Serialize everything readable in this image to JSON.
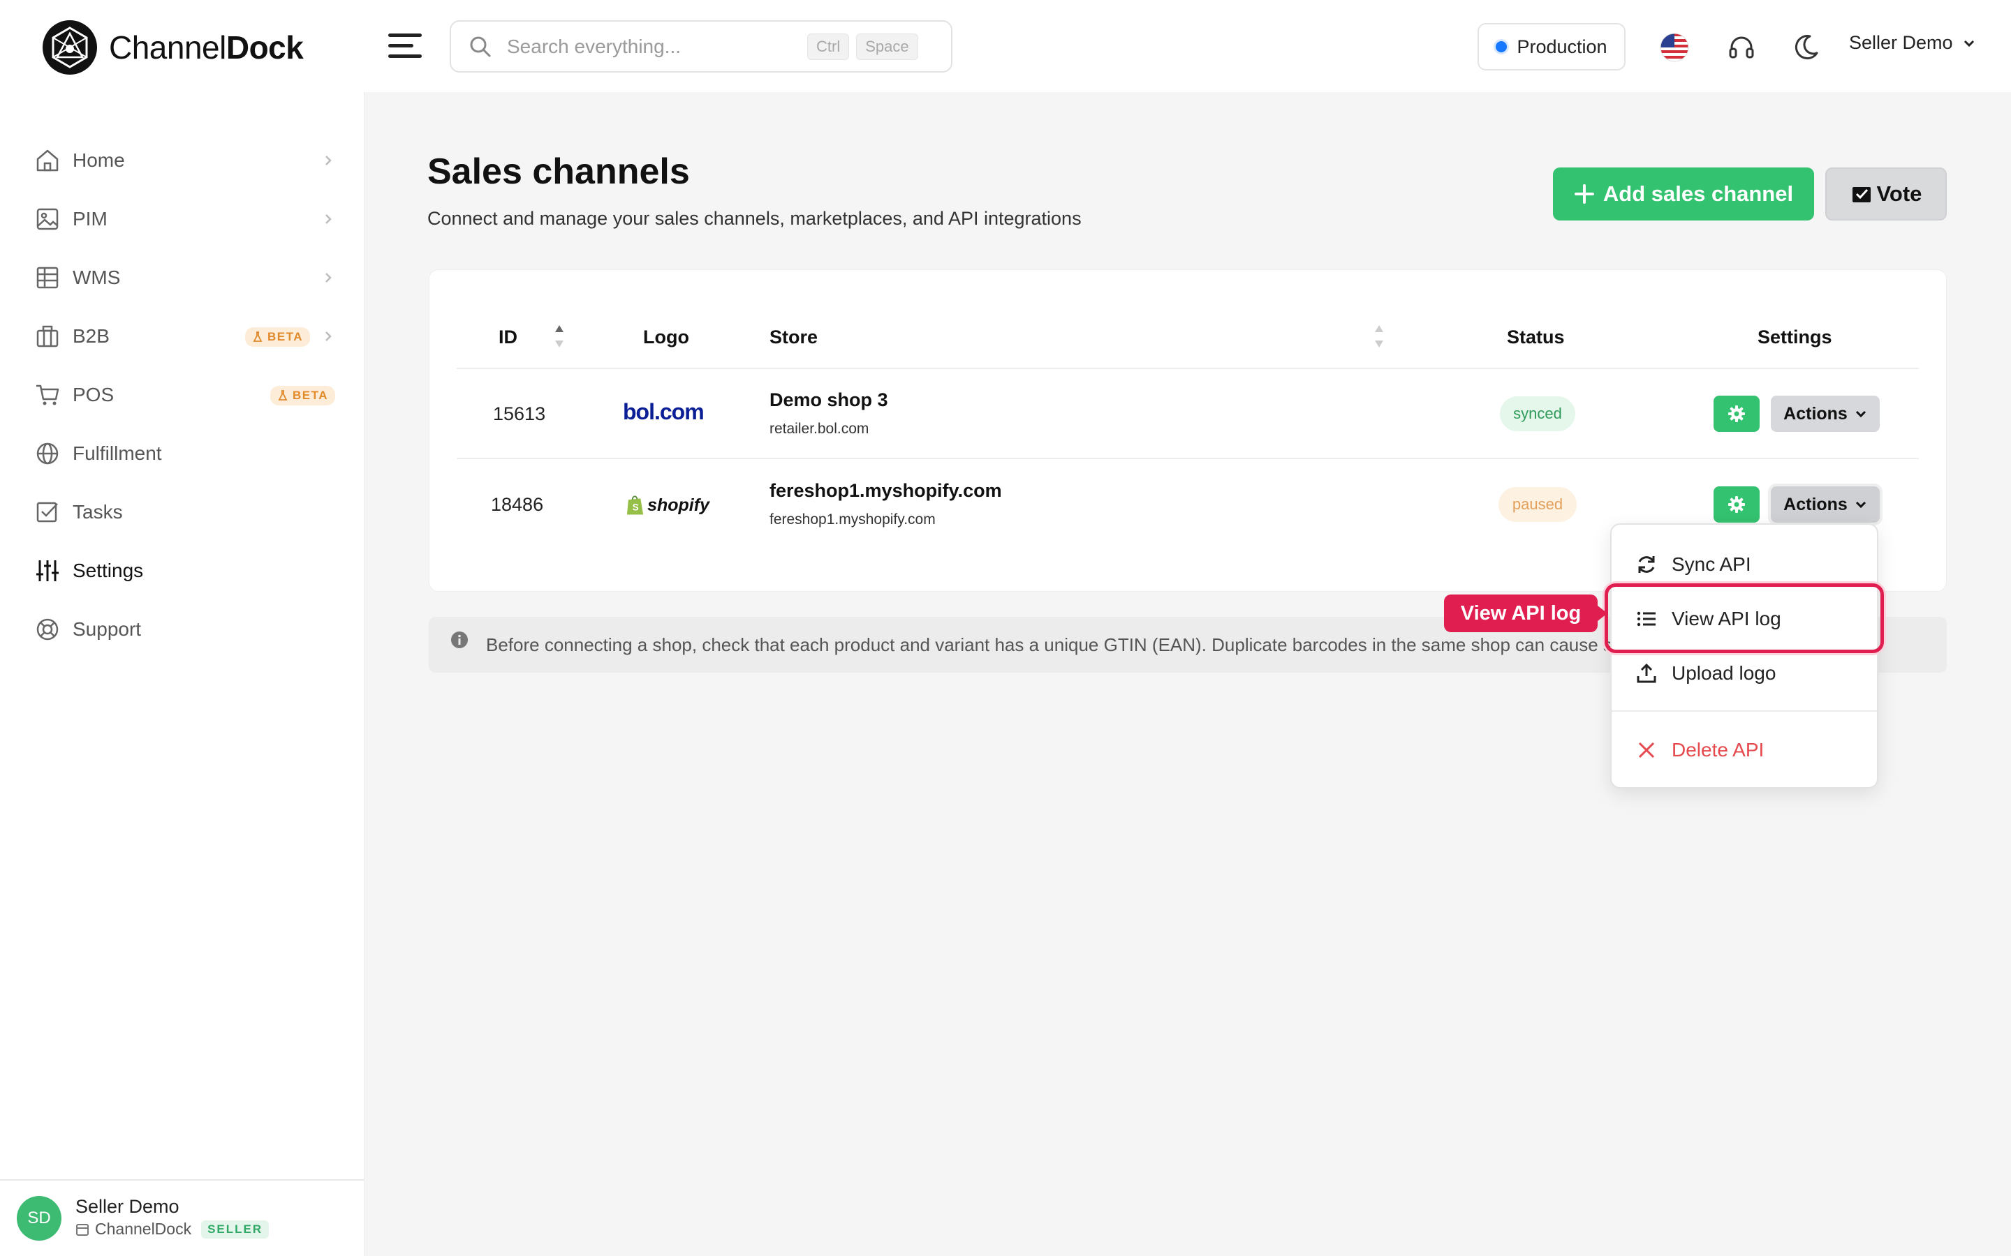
{
  "brand": {
    "name_regular": "Channel",
    "name_bold": "Dock"
  },
  "header": {
    "search_placeholder": "Search everything...",
    "shortcut_keys": [
      "Ctrl",
      "Space"
    ],
    "environment": "Production",
    "user_menu": "Seller Demo"
  },
  "sidebar": {
    "items": [
      {
        "label": "Home",
        "icon": "home-icon"
      },
      {
        "label": "PIM",
        "icon": "image-icon"
      },
      {
        "label": "WMS",
        "icon": "grid-icon"
      },
      {
        "label": "B2B",
        "icon": "briefcase-icon",
        "badge": "BETA"
      },
      {
        "label": "POS",
        "icon": "cart-icon",
        "badge": "BETA"
      },
      {
        "label": "Fulfillment",
        "icon": "globe-icon"
      },
      {
        "label": "Tasks",
        "icon": "check-square-icon"
      },
      {
        "label": "Settings",
        "icon": "sliders-icon",
        "active": true
      },
      {
        "label": "Support",
        "icon": "lifebuoy-icon"
      }
    ],
    "footer": {
      "initials": "SD",
      "name": "Seller Demo",
      "org": "ChannelDock",
      "role": "SELLER"
    }
  },
  "page": {
    "title": "Sales channels",
    "subtitle": "Connect and manage your sales channels, marketplaces, and API integrations",
    "add_button": "Add sales channel",
    "vote_button": "Vote"
  },
  "table": {
    "headers": {
      "id": "ID",
      "logo": "Logo",
      "store": "Store",
      "status": "Status",
      "settings": "Settings"
    },
    "actions_label": "Actions",
    "rows": [
      {
        "id": "15613",
        "logo": "bol.com",
        "store": "Demo shop 3",
        "host": "retailer.bol.com",
        "status": "synced"
      },
      {
        "id": "18486",
        "logo": "shopify",
        "store": "fereshop1.myshopify.com",
        "host": "fereshop1.myshopify.com",
        "status": "paused"
      }
    ]
  },
  "notice": "Before connecting a shop, check that each product and variant has a unique GTIN (EAN). Duplicate barcodes in the same shop can cause sync errors.",
  "dropdown": {
    "sync": "Sync API",
    "view_log": "View API log",
    "upload_logo": "Upload logo",
    "delete": "Delete API"
  },
  "callout": "View API log",
  "colors": {
    "accent_green": "#33c26f",
    "highlight_red": "#e01e4f",
    "env_blue": "#1677ff",
    "bol_blue": "#0a1e96",
    "shopify_green": "#95bf47"
  }
}
